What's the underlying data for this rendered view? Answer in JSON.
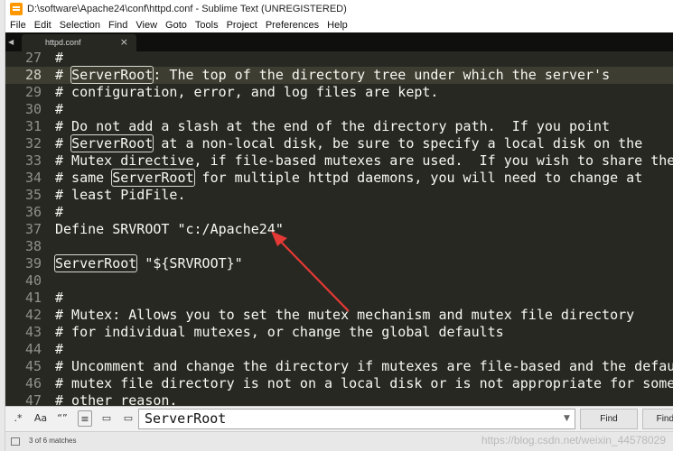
{
  "window": {
    "title": "D:\\software\\Apache24\\conf\\httpd.conf - Sublime Text (UNREGISTERED)"
  },
  "menu": {
    "items": [
      "File",
      "Edit",
      "Selection",
      "Find",
      "View",
      "Goto",
      "Tools",
      "Project",
      "Preferences",
      "Help"
    ]
  },
  "tabs": [
    {
      "label": "httpd.conf",
      "close": "×"
    }
  ],
  "editor": {
    "lines": [
      {
        "num": "27",
        "text": "#"
      },
      {
        "num": "28",
        "pre": "# ",
        "hl": "ServerRoot",
        "post": ": The top of the directory tree under which the server's",
        "current": true
      },
      {
        "num": "29",
        "text": "# configuration, error, and log files are kept."
      },
      {
        "num": "30",
        "text": "#"
      },
      {
        "num": "31",
        "text": "# Do not add a slash at the end of the directory path.  If you point"
      },
      {
        "num": "32",
        "pre": "# ",
        "hl": "ServerRoot",
        "post": " at a non-local disk, be sure to specify a local disk on the"
      },
      {
        "num": "33",
        "text": "# Mutex directive, if file-based mutexes are used.  If you wish to share the"
      },
      {
        "num": "34",
        "pre": "# same ",
        "hl": "ServerRoot",
        "post": " for multiple httpd daemons, you will need to change at"
      },
      {
        "num": "35",
        "text": "# least PidFile."
      },
      {
        "num": "36",
        "text": "#"
      },
      {
        "num": "37",
        "text": "Define SRVROOT \"c:/Apache24\""
      },
      {
        "num": "38",
        "text": ""
      },
      {
        "num": "39",
        "pre": "",
        "hl": "ServerRoot",
        "post": " \"${SRVROOT}\""
      },
      {
        "num": "40",
        "text": ""
      },
      {
        "num": "41",
        "text": "#"
      },
      {
        "num": "42",
        "text": "# Mutex: Allows you to set the mutex mechanism and mutex file directory"
      },
      {
        "num": "43",
        "text": "# for individual mutexes, or change the global defaults"
      },
      {
        "num": "44",
        "text": "#"
      },
      {
        "num": "45",
        "text": "# Uncomment and change the directory if mutexes are file-based and the default"
      },
      {
        "num": "46",
        "text": "# mutex file directory is not on a local disk or is not appropriate for some"
      },
      {
        "num": "47",
        "text": "# other reason."
      }
    ]
  },
  "find": {
    "options": [
      ".*",
      "Aa",
      "“”",
      "≡",
      "▭",
      "▭"
    ],
    "value": "ServerRoot",
    "find_label": "Find",
    "find_all_label": "Find All"
  },
  "status": {
    "text": "3 of 6 matches",
    "watermark": "https://blog.csdn.net/weixin_44578029"
  },
  "colors": {
    "editor_bg": "#272822",
    "arrow": "#e53935"
  }
}
